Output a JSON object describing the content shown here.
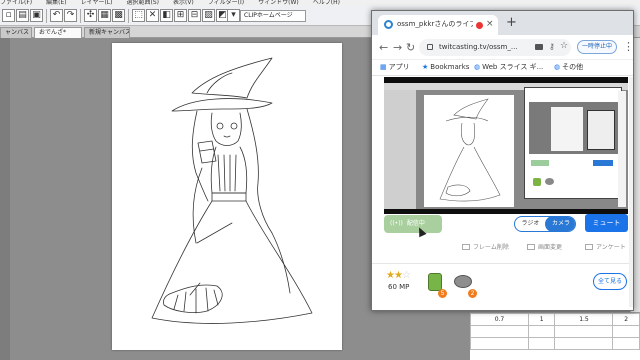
{
  "host_app": {
    "menu": [
      "ファイル(F)",
      "編集(E)",
      "レイヤー(L)",
      "選択範囲(S)",
      "表示(V)",
      "フィルター(I)",
      "ウィンドウ(W)",
      "ヘルプ(H)"
    ],
    "cloud_pill": "CLIPホームページ",
    "tabs": [
      "ャンバス",
      "おでんざ*",
      "新規キャンバス"
    ],
    "sheet_rows": [
      [
        "0.7",
        "1",
        "1.5",
        "2"
      ],
      [
        "",
        "",
        "",
        ""
      ],
      [
        "",
        "",
        "",
        ""
      ]
    ]
  },
  "browser": {
    "tab_title": "ossm_pkkrさんのライブ配信",
    "tab_close": "×",
    "new_tab": "+",
    "nav": {
      "back": "←",
      "forward": "→",
      "reload": "↻"
    },
    "url": "twitcasting.tv/ossm_...",
    "pause_label": "一時停止中",
    "menu_dots": "⋮",
    "bookmarks": [
      {
        "label": "アプリ",
        "icon": "apps-icon"
      },
      {
        "label": "Bookmarks",
        "icon": "star-icon"
      },
      {
        "label": "Web スライス ギ...",
        "icon": "globe-icon"
      },
      {
        "label": "その他",
        "icon": "globe-icon"
      }
    ]
  },
  "broadcast": {
    "onair_label": "配信中",
    "onair_glyph": "((•))",
    "toggle": {
      "left": "ラジオ",
      "right": "カメラ",
      "selected": "カメラ"
    },
    "mute_label": "ミュート",
    "actions": [
      "フレーム削除",
      "画面変更",
      "アンケート"
    ],
    "rating_stars_full": "★★",
    "rating_stars_empty": "☆",
    "mp_label": "60 MP",
    "item_badge_1": "5",
    "item_badge_2": "2",
    "see_more_label": "全て見る"
  },
  "colors": {
    "accent_blue": "#1a73e8",
    "onair_green": "#a9cf9f",
    "badge_orange": "#f07c1d",
    "star_gold": "#e3a91d"
  }
}
